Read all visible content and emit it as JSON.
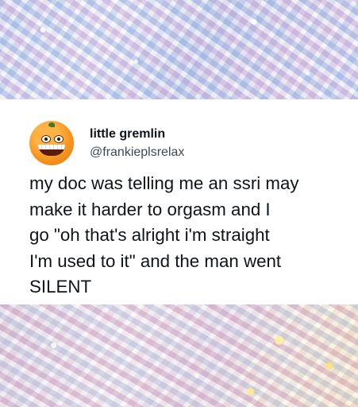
{
  "tweet": {
    "display_name": "little gremlin",
    "handle": "@frankieplsrelax",
    "avatar_icon": "annoying-orange-avatar",
    "lines": [
      "my doc was telling me an ssri may",
      "make it harder to orgasm and I",
      "go \"oh that's alright i'm straight",
      "I'm used to it\" and the man went",
      "SILENT"
    ]
  },
  "colors": {
    "name": "#0f1419",
    "handle": "#3d4a55",
    "background": "#ffffff"
  }
}
